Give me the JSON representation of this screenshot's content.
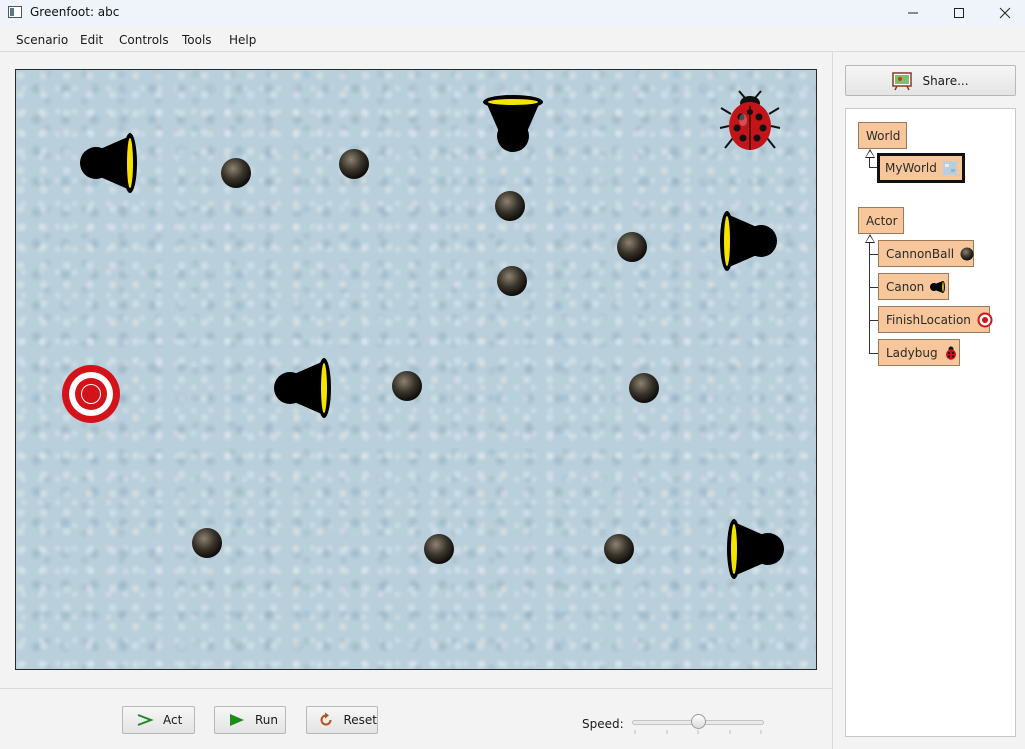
{
  "window": {
    "title": "Greenfoot: abc"
  },
  "menu": [
    "Scenario",
    "Edit",
    "Controls",
    "Tools",
    "Help"
  ],
  "controls": {
    "act_label": "Act",
    "run_label": "Run",
    "reset_label": "Reset",
    "speed_label": "Speed:",
    "speed_value": 0.5
  },
  "share_label": "Share...",
  "classes": {
    "world": {
      "label": "World",
      "children": [
        {
          "label": "MyWorld"
        }
      ]
    },
    "actor": {
      "label": "Actor",
      "children": [
        {
          "label": "CannonBall"
        },
        {
          "label": "Canon"
        },
        {
          "label": "FinishLocation"
        },
        {
          "label": "Ladybug"
        }
      ]
    }
  },
  "world_actors": [
    "canon",
    "canon",
    "canon",
    "canon",
    "canonball",
    "finish-location",
    "ladybug"
  ],
  "colors": {
    "class_box": "#f7c79b",
    "run_arrow": "#1f8a1f",
    "target_red": "#d4121a",
    "canon_band": "#f5e400"
  }
}
